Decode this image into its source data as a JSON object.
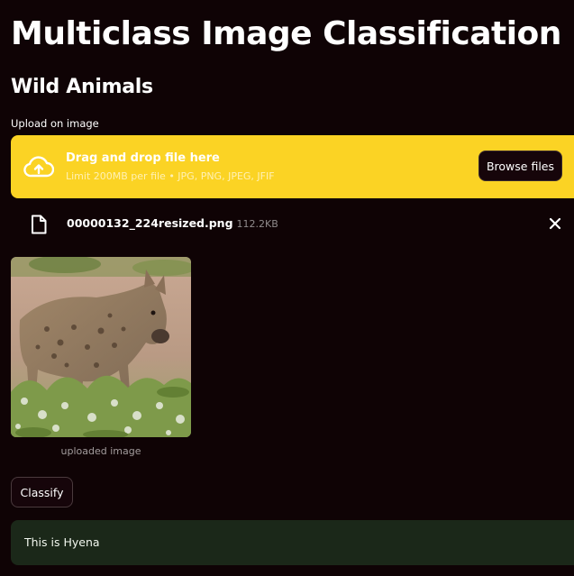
{
  "page": {
    "title": "Multiclass Image Classification",
    "subtitle": "Wild Animals"
  },
  "uploader": {
    "label": "Upload on image",
    "dropzone_title": "Drag and drop file here",
    "dropzone_limit": "Limit 200MB per file • JPG, PNG, JPEG, JFIF",
    "browse_label": "Browse files",
    "icon": "cloud-upload-icon"
  },
  "uploaded_file": {
    "name": "00000132_224resized.png",
    "size": "112.2KB",
    "file_icon": "file-icon",
    "remove_icon": "close-icon"
  },
  "image": {
    "caption": "uploaded image"
  },
  "actions": {
    "classify_label": "Classify"
  },
  "result": {
    "text": "This is Hyena"
  },
  "colors": {
    "background": "#0f0305",
    "dropzone": "#fbd324",
    "result_background": "#1b2819"
  }
}
